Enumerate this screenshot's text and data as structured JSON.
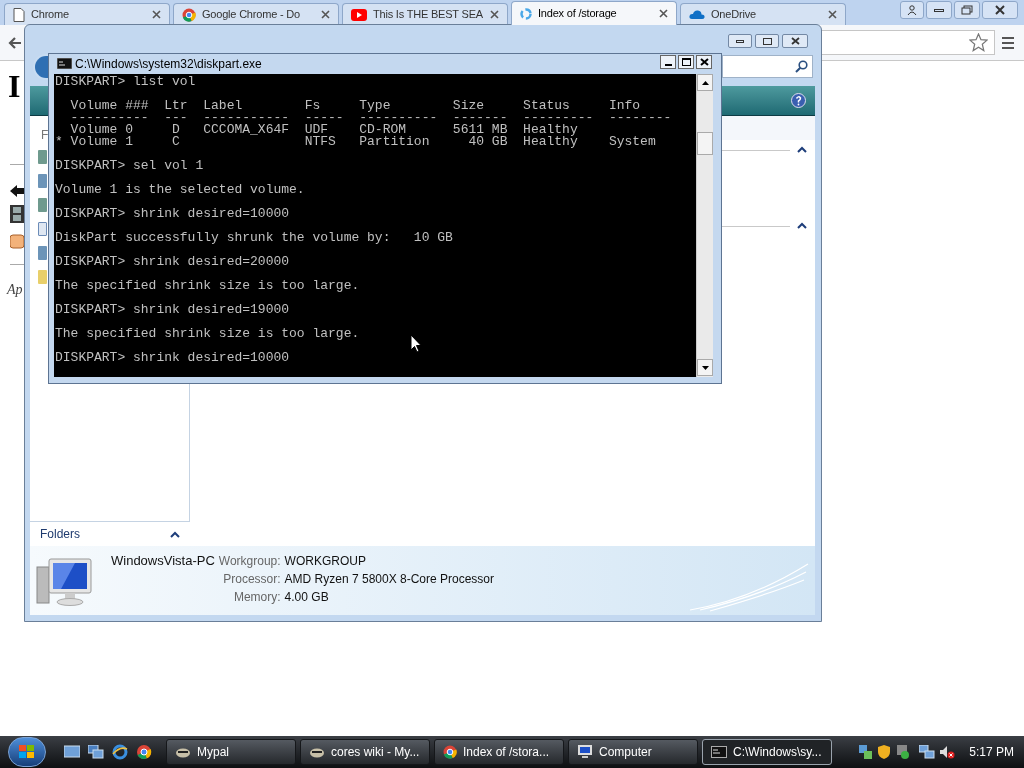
{
  "browser": {
    "tabs": [
      {
        "title": "Chrome",
        "kind": "page",
        "selected": false
      },
      {
        "title": "Google Chrome - Do",
        "kind": "chrome",
        "selected": false
      },
      {
        "title": "This Is THE BEST SEA",
        "kind": "video",
        "selected": false
      },
      {
        "title": "Index of /storage",
        "kind": "loading",
        "selected": true
      },
      {
        "title": "OneDrive",
        "kind": "cloud",
        "selected": false
      }
    ],
    "page": {
      "heading": "I",
      "italic_text": "Ap"
    }
  },
  "explorer": {
    "nav_letter": "F",
    "folders_label": "Folders",
    "computer": {
      "name": "WindowsVista-PC",
      "details": [
        {
          "label": "Workgroup:",
          "value": "WORKGROUP"
        },
        {
          "label": "Processor:",
          "value": "AMD Ryzen 7 5800X 8-Core Processor"
        },
        {
          "label": "Memory:",
          "value": "4.00 GB"
        }
      ]
    }
  },
  "console": {
    "title": "C:\\Windows\\system32\\diskpart.exe",
    "blocks": [
      [
        "DISKPART> list vol"
      ],
      [
        "  Volume ###  Ltr  Label        Fs     Type        Size     Status     Info",
        "  ----------  ---  -----------  -----  ----------  -------  ---------  --------",
        "  Volume 0     D   CCCOMA_X64F  UDF    CD-ROM      5611 MB  Healthy",
        "* Volume 1     C                NTFS   Partition     40 GB  Healthy    System"
      ],
      [
        "DISKPART> sel vol 1"
      ],
      [
        "Volume 1 is the selected volume."
      ],
      [
        "DISKPART> shrink desired=10000"
      ],
      [
        "DiskPart successfully shrunk the volume by:   10 GB"
      ],
      [
        "DISKPART> shrink desired=20000"
      ],
      [
        "The specified shrink size is too large."
      ],
      [
        "DISKPART> shrink desired=19000"
      ],
      [
        "The specified shrink size is too large."
      ],
      [
        "DISKPART> shrink desired=10000"
      ]
    ]
  },
  "taskbar": {
    "tasks": [
      {
        "label": "Mypal",
        "kind": "animal",
        "selected": false
      },
      {
        "label": "cores wiki - My...",
        "kind": "animal",
        "selected": false
      },
      {
        "label": "Index of /stora...",
        "kind": "chrome",
        "selected": false
      },
      {
        "label": "Computer",
        "kind": "computer",
        "selected": false
      },
      {
        "label": "C:\\Windows\\sy...",
        "kind": "console",
        "selected": true
      }
    ],
    "clock": "5:17 PM"
  }
}
